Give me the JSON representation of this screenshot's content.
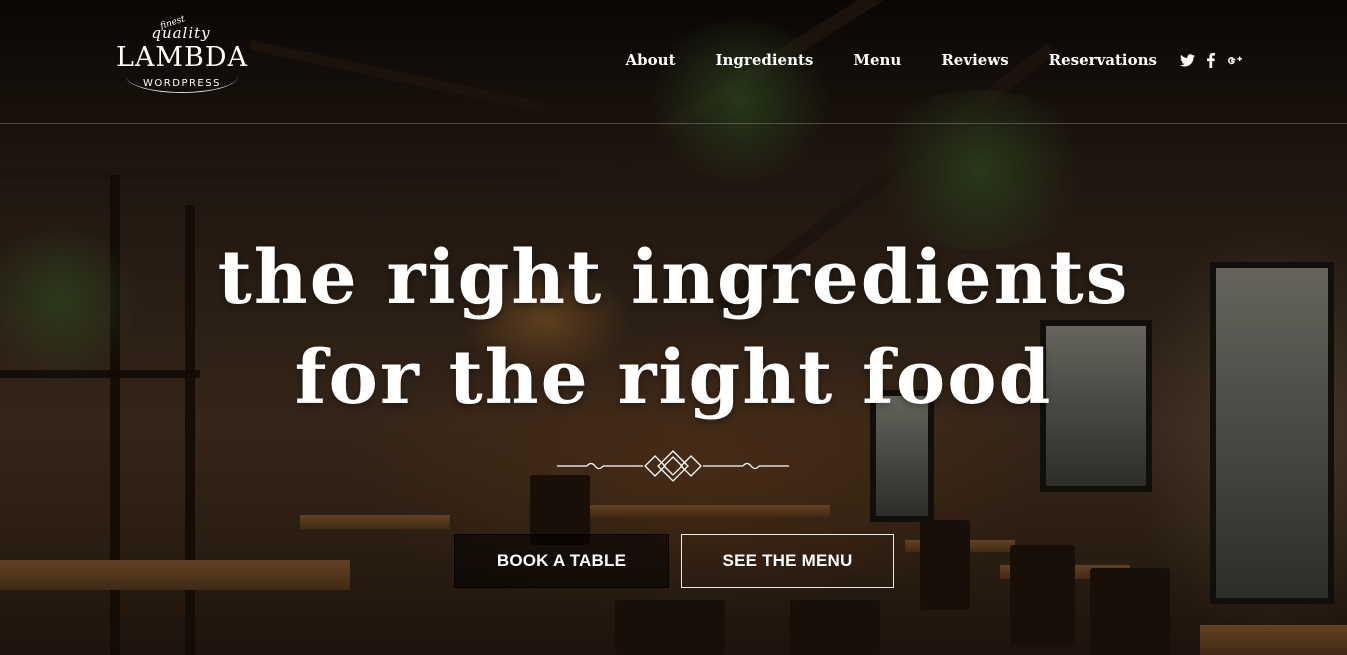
{
  "logo": {
    "finest": "finest",
    "quality": "quality",
    "name": "LAMBDA",
    "sub": "WORDPRESS"
  },
  "nav": {
    "items": [
      {
        "label": "About"
      },
      {
        "label": "Ingredients"
      },
      {
        "label": "Menu"
      },
      {
        "label": "Reviews"
      },
      {
        "label": "Reservations"
      }
    ]
  },
  "social": {
    "twitter": {
      "glyph": "𝕥",
      "icon": "twitter-icon"
    },
    "facebook": {
      "glyph": "f",
      "icon": "facebook-icon"
    },
    "googleplus": {
      "glyph": "g+",
      "icon": "google-plus-icon"
    }
  },
  "hero": {
    "headline_line1": "the right ingredients",
    "headline_line2": "for the right food",
    "divider_icon": "ornamental-divider-icon"
  },
  "buttons": {
    "book": "BOOK A TABLE",
    "menu": "SEE THE MENU"
  },
  "colors": {
    "text": "#ffffff",
    "header_border": "rgba(255,255,255,0.22)"
  }
}
